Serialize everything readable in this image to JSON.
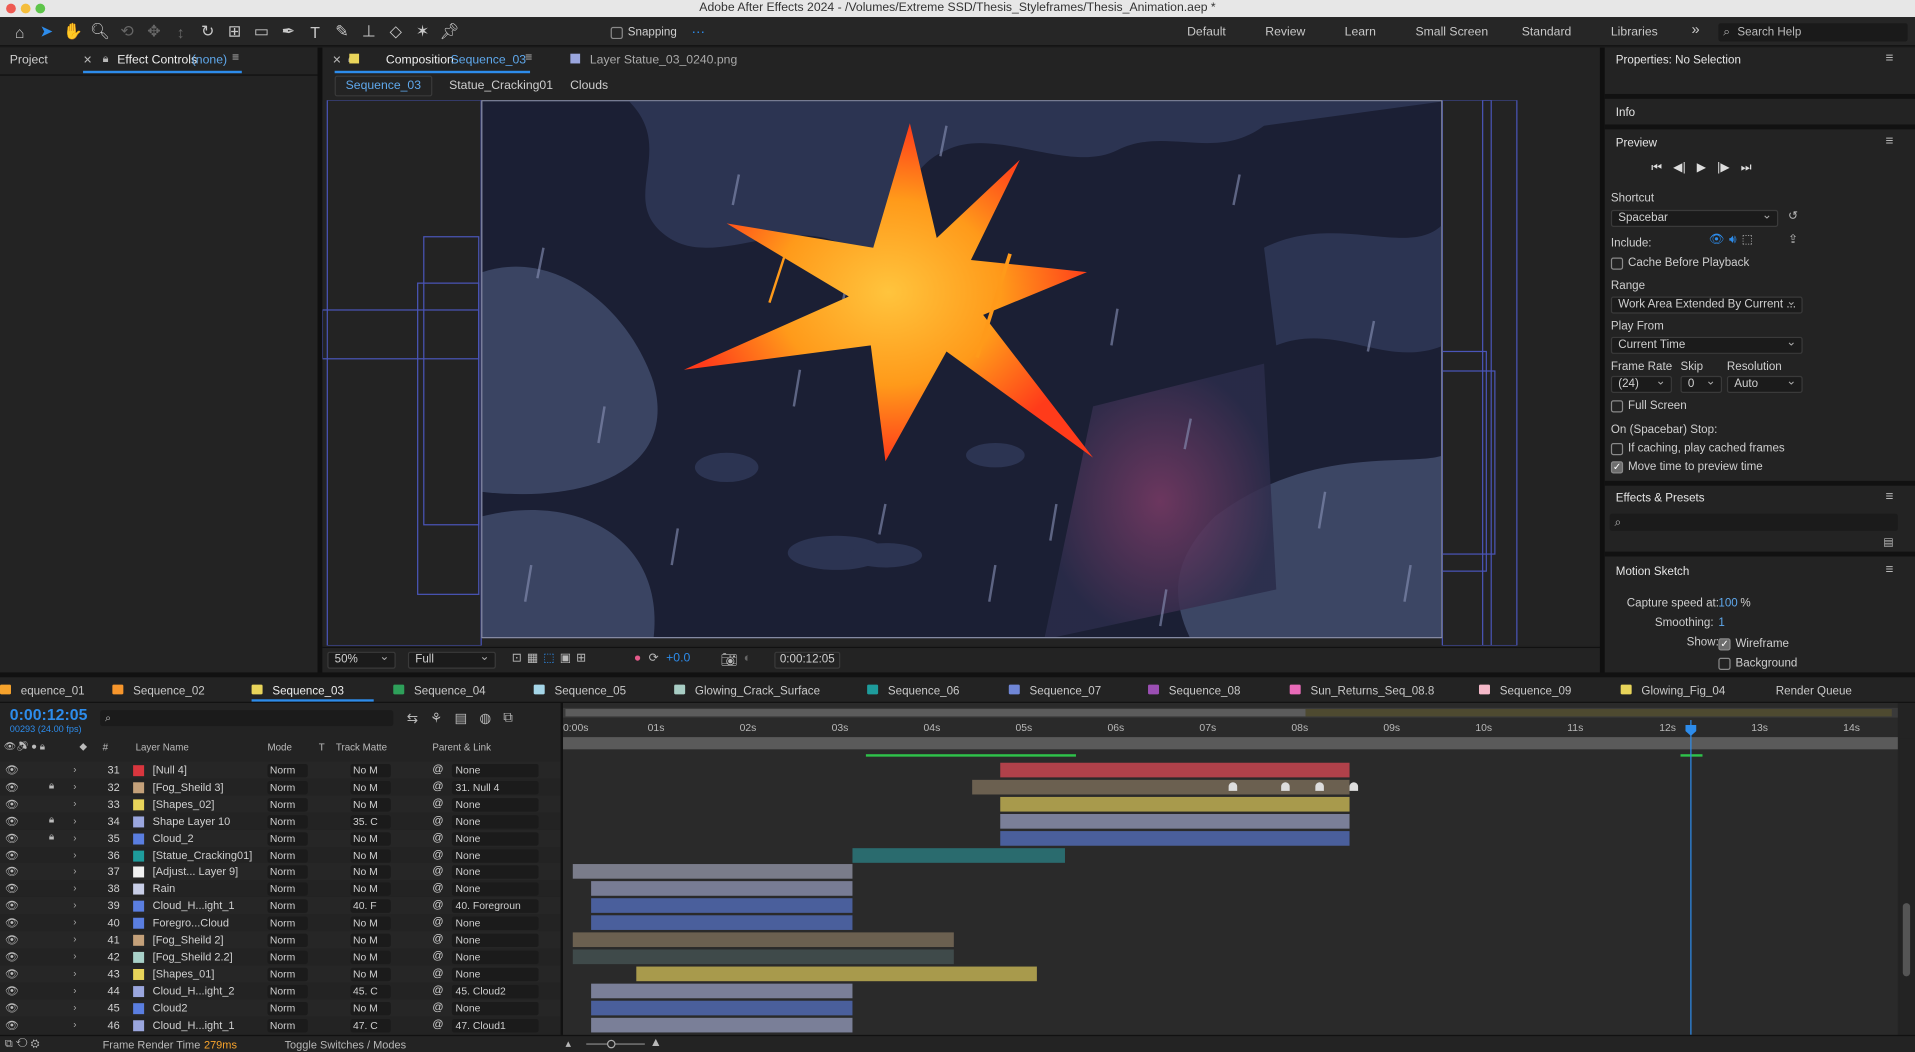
{
  "window": {
    "title": "Adobe After Effects 2024 - /Volumes/Extreme SSD/Thesis_Styleframes/Thesis_Animation.aep *"
  },
  "toolbar": {
    "snapping": "Snapping",
    "workspaces": [
      "Default",
      "Review",
      "Learn",
      "Small Screen",
      "Standard",
      "Libraries"
    ],
    "search_placeholder": "Search Help"
  },
  "left_panel": {
    "project_tab": "Project",
    "effect_controls_tab": "Effect Controls",
    "effect_controls_target": "(none)"
  },
  "comp_panel": {
    "tab_label": "Composition",
    "tab_comp": "Sequence_03",
    "layer_tab": "Layer Statue_03_0240.png",
    "breadcrumbs": [
      "Sequence_03",
      "Statue_Cracking01",
      "Clouds"
    ],
    "zoom": "50%",
    "resolution": "Full",
    "exposure": "+0.0",
    "timecode": "0:00:12:05"
  },
  "properties": {
    "title": "Properties: No Selection",
    "info": "Info",
    "preview": "Preview",
    "shortcut_label": "Shortcut",
    "shortcut_value": "Spacebar",
    "include_label": "Include:",
    "cache_before_playback": "Cache Before Playback",
    "range_label": "Range",
    "range_value": "Work Area Extended By Current ...",
    "play_from_label": "Play From",
    "play_from_value": "Current Time",
    "frame_rate_label": "Frame Rate",
    "skip_label": "Skip",
    "resolution_label": "Resolution",
    "frame_rate_value": "(24)",
    "skip_value": "0",
    "resolution_value": "Auto",
    "full_screen": "Full Screen",
    "on_stop_label": "On (Spacebar) Stop:",
    "if_caching": "If caching, play cached frames",
    "move_time": "Move time to preview time",
    "effects_presets": "Effects & Presets",
    "motion_sketch": "Motion Sketch",
    "capture_speed_label": "Capture speed at:",
    "capture_speed_value": "100",
    "capture_speed_unit": "%",
    "smoothing_label": "Smoothing:",
    "smoothing_value": "1",
    "show_label": "Show:",
    "wireframe": "Wireframe",
    "background": "Background"
  },
  "timeline": {
    "tabs": [
      {
        "label": "equence_01",
        "color": "#f7a32c"
      },
      {
        "label": "Sequence_02",
        "color": "#f7962c"
      },
      {
        "label": "Sequence_03",
        "color": "#e8d45a"
      },
      {
        "label": "Sequence_04",
        "color": "#2ea05a"
      },
      {
        "label": "Sequence_05",
        "color": "#a5d6e8"
      },
      {
        "label": "Glowing_Crack_Surface",
        "color": "#a8cdc4"
      },
      {
        "label": "Sequence_06",
        "color": "#1e9c9c"
      },
      {
        "label": "Sequence_07",
        "color": "#6f86d6"
      },
      {
        "label": "Sequence_08",
        "color": "#9b4fb3"
      },
      {
        "label": "Sun_Returns_Seq_08.8",
        "color": "#e86ab8"
      },
      {
        "label": "Sequence_09",
        "color": "#f4b8c8"
      },
      {
        "label": "Glowing_Fig_04",
        "color": "#e8d45a"
      },
      {
        "label": "Render Queue",
        "color": ""
      }
    ],
    "current_time": "0:00:12:05",
    "frame_info": "00293 (24.00 fps)",
    "columns": {
      "hash": "#",
      "layer_name": "Layer Name",
      "mode": "Mode",
      "t": "T",
      "track_matte": "Track Matte",
      "parent": "Parent & Link"
    },
    "ruler": [
      "0:00s",
      "01s",
      "02s",
      "03s",
      "04s",
      "05s",
      "06s",
      "07s",
      "08s",
      "09s",
      "10s",
      "11s",
      "12s",
      "13s",
      "14s"
    ],
    "layers": [
      {
        "num": "31",
        "color": "#d9363e",
        "name": "[Null 4]",
        "mode": "Norm",
        "matte": "No M",
        "parent": "None",
        "start": 4.7,
        "end": 8.5,
        "bar": "#b0414a",
        "lock": false
      },
      {
        "num": "32",
        "color": "#c4a17a",
        "name": "[Fog_Sheild 3]",
        "mode": "Norm",
        "matte": "No M",
        "parent": "31. Null 4",
        "start": 4.4,
        "end": 8.5,
        "bar": "#6b6050",
        "lock": true
      },
      {
        "num": "33",
        "color": "#e8d45a",
        "name": "[Shapes_02]",
        "mode": "Norm",
        "matte": "No M",
        "parent": "None",
        "start": 4.7,
        "end": 8.5,
        "bar": "#a89a4c",
        "lock": false
      },
      {
        "num": "34",
        "color": "#9aa6de",
        "name": "Shape Layer 10",
        "mode": "Norm",
        "matte": "35. C",
        "parent": "None",
        "start": 4.7,
        "end": 8.5,
        "bar": "#7a7f98",
        "lock": true
      },
      {
        "num": "35",
        "color": "#5a7ee0",
        "name": "Cloud_2",
        "mode": "Norm",
        "matte": "No M",
        "parent": "None",
        "start": 4.7,
        "end": 8.5,
        "bar": "#4a5f9c",
        "lock": true
      },
      {
        "num": "36",
        "color": "#1e9c9c",
        "name": "[Statue_Cracking01]",
        "mode": "Norm",
        "matte": "No M",
        "parent": "None",
        "start": 3.1,
        "end": 5.4,
        "bar": "#2a6b6e",
        "lock": false
      },
      {
        "num": "37",
        "color": "#f0f0f0",
        "name": "[Adjust... Layer 9]",
        "mode": "Norm",
        "matte": "No M",
        "parent": "None",
        "start": 0.05,
        "end": 3.1,
        "bar": "#7a7c8a",
        "lock": false
      },
      {
        "num": "38",
        "color": "#c7cde6",
        "name": "Rain",
        "mode": "Norm",
        "matte": "No M",
        "parent": "None",
        "start": 0.25,
        "end": 3.1,
        "bar": "#787c94",
        "lock": false
      },
      {
        "num": "39",
        "color": "#5a7ee0",
        "name": "Cloud_H...ight_1",
        "mode": "Norm",
        "matte": "40. F",
        "parent": "40. Foregroun",
        "start": 0.25,
        "end": 3.1,
        "bar": "#4a5f9c",
        "lock": false
      },
      {
        "num": "40",
        "color": "#5a7ee0",
        "name": "Foregro...Cloud",
        "mode": "Norm",
        "matte": "No M",
        "parent": "None",
        "start": 0.25,
        "end": 3.1,
        "bar": "#4a5f9c",
        "lock": false
      },
      {
        "num": "41",
        "color": "#c4a17a",
        "name": "[Fog_Sheild 2]",
        "mode": "Norm",
        "matte": "No M",
        "parent": "None",
        "start": 0.05,
        "end": 4.2,
        "bar": "#6b6050",
        "lock": false
      },
      {
        "num": "42",
        "color": "#a8d0c8",
        "name": "[Fog_Sheild 2.2]",
        "mode": "Norm",
        "matte": "No M",
        "parent": "None",
        "start": 0.05,
        "end": 4.2,
        "bar": "#3f4a4a",
        "lock": false
      },
      {
        "num": "43",
        "color": "#e8d45a",
        "name": "[Shapes_01]",
        "mode": "Norm",
        "matte": "No M",
        "parent": "None",
        "start": 0.75,
        "end": 5.1,
        "bar": "#a89a4c",
        "lock": false
      },
      {
        "num": "44",
        "color": "#9aa6de",
        "name": "Cloud_H...ight_2",
        "mode": "Norm",
        "matte": "45. C",
        "parent": "45. Cloud2",
        "start": 0.25,
        "end": 3.1,
        "bar": "#7a7f98",
        "lock": false
      },
      {
        "num": "45",
        "color": "#5a7ee0",
        "name": "Cloud2",
        "mode": "Norm",
        "matte": "No M",
        "parent": "None",
        "start": 0.25,
        "end": 3.1,
        "bar": "#4a5f9c",
        "lock": false
      },
      {
        "num": "46",
        "color": "#9aa6de",
        "name": "Cloud_H...ight_1",
        "mode": "Norm",
        "matte": "47. C",
        "parent": "47. Cloud1",
        "start": 0.25,
        "end": 3.1,
        "bar": "#7a7f98",
        "lock": false
      }
    ],
    "footer": {
      "render_label": "Frame Render Time",
      "render_value": "279ms",
      "toggle": "Toggle Switches / Modes"
    }
  }
}
